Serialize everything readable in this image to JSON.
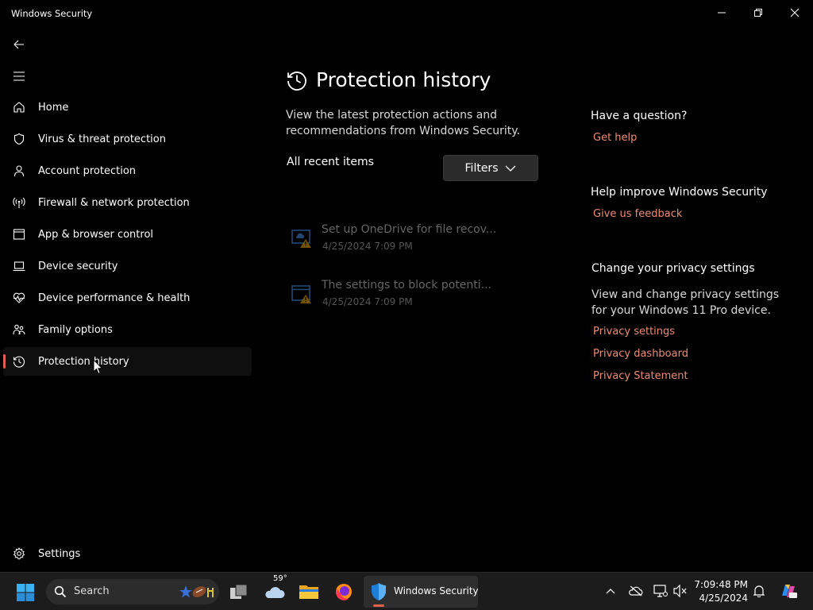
{
  "window": {
    "title": "Windows Security"
  },
  "nav": {
    "items": [
      {
        "label": "Home",
        "icon": "home-icon"
      },
      {
        "label": "Virus & threat protection",
        "icon": "shield-icon"
      },
      {
        "label": "Account protection",
        "icon": "person-icon"
      },
      {
        "label": "Firewall & network protection",
        "icon": "antenna-icon"
      },
      {
        "label": "App & browser control",
        "icon": "browser-window-icon"
      },
      {
        "label": "Device security",
        "icon": "laptop-icon"
      },
      {
        "label": "Device performance & health",
        "icon": "heart-pulse-icon"
      },
      {
        "label": "Family options",
        "icon": "family-icon"
      },
      {
        "label": "Protection history",
        "icon": "history-icon",
        "active": true
      }
    ],
    "settings_label": "Settings"
  },
  "main": {
    "title": "Protection history",
    "subtitle": "View the latest protection actions and recommendations from Windows Security.",
    "recent_label": "All recent items",
    "filters_label": "Filters",
    "history": [
      {
        "title": "Set up OneDrive for file recov...",
        "date": "4/25/2024 7:09 PM",
        "icon": "onedrive-warning-icon"
      },
      {
        "title": "The settings to block potenti...",
        "date": "4/25/2024 7:09 PM",
        "icon": "app-warning-icon"
      }
    ]
  },
  "side": {
    "question_heading": "Have a question?",
    "get_help": "Get help",
    "improve_heading": "Help improve Windows Security",
    "feedback": "Give us feedback",
    "privacy_heading": "Change your privacy settings",
    "privacy_text": "View and change privacy settings for your Windows 11 Pro device.",
    "privacy_links": [
      "Privacy settings",
      "Privacy dashboard",
      "Privacy Statement"
    ]
  },
  "taskbar": {
    "search_label": "Search",
    "weather_temp": "59°",
    "active_app_label": "Windows Security",
    "time": "7:09:48 PM",
    "date": "4/25/2024"
  },
  "colors": {
    "accent": "#e0604f",
    "link": "#f08a73",
    "background": "#000000",
    "taskbar": "#1c1c1c"
  }
}
